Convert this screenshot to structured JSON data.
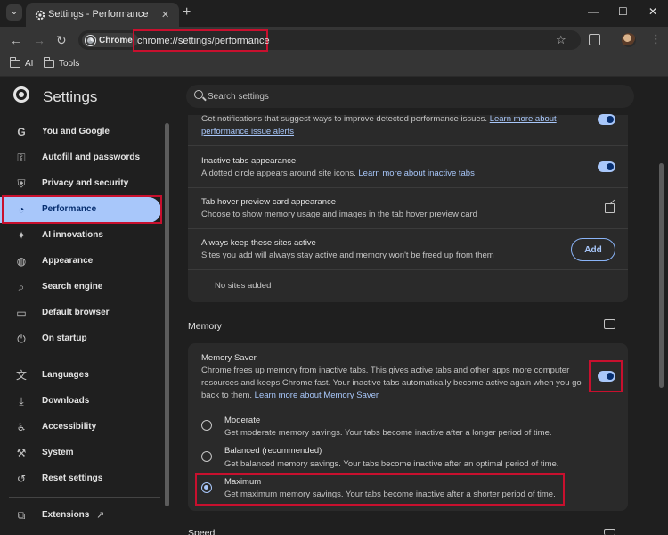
{
  "browser": {
    "tab_title": "Settings - Performance",
    "chip_label": "Chrome",
    "url": "chrome://settings/performance",
    "bookmarks": [
      "AI",
      "Tools"
    ]
  },
  "settings": {
    "title": "Settings",
    "search_placeholder": "Search settings"
  },
  "sidebar": {
    "items": [
      {
        "label": "You and Google",
        "icon": "google-g-icon"
      },
      {
        "label": "Autofill and passwords",
        "icon": "key-icon"
      },
      {
        "label": "Privacy and security",
        "icon": "shield-icon"
      },
      {
        "label": "Performance",
        "icon": "speedometer-icon",
        "active": true
      },
      {
        "label": "AI innovations",
        "icon": "sparkle-icon"
      },
      {
        "label": "Appearance",
        "icon": "palette-icon"
      },
      {
        "label": "Search engine",
        "icon": "search-icon"
      },
      {
        "label": "Default browser",
        "icon": "browser-window-icon"
      },
      {
        "label": "On startup",
        "icon": "power-icon"
      },
      {
        "label": "Languages",
        "icon": "translate-icon"
      },
      {
        "label": "Downloads",
        "icon": "download-icon"
      },
      {
        "label": "Accessibility",
        "icon": "accessibility-icon"
      },
      {
        "label": "System",
        "icon": "wrench-icon"
      },
      {
        "label": "Reset settings",
        "icon": "reset-icon"
      },
      {
        "label": "Extensions",
        "icon": "puzzle-icon"
      }
    ]
  },
  "performance": {
    "alerts_desc_1": "Get notifications that suggest ways to improve detected performance issues.",
    "alerts_link": "Learn more about",
    "alerts_link_2": "performance issue alerts",
    "inactive_title": "Inactive tabs appearance",
    "inactive_desc": "A dotted circle appears around site icons.",
    "inactive_link": "Learn more about inactive tabs",
    "hover_title": "Tab hover preview card appearance",
    "hover_desc": "Choose to show memory usage and images in the tab hover preview card",
    "active_title": "Always keep these sites active",
    "active_desc": "Sites you add will always stay active and memory won't be freed up from them",
    "add_label": "Add",
    "no_sites": "No sites added"
  },
  "memory": {
    "section_title": "Memory",
    "saver_title": "Memory Saver",
    "saver_desc_1": "Chrome frees up memory from inactive tabs. This gives active tabs and other apps more computer",
    "saver_desc_2": "resources and keeps Chrome fast. Your inactive tabs automatically become active again when you go",
    "saver_desc_3": "back to them.",
    "saver_link": "Learn more about Memory Saver",
    "options": [
      {
        "title": "Moderate",
        "desc": "Get moderate memory savings. Your tabs become inactive after a longer period of time.",
        "selected": false
      },
      {
        "title": "Balanced (recommended)",
        "desc": "Get balanced memory savings. Your tabs become inactive after an optimal period of time.",
        "selected": false
      },
      {
        "title": "Maximum",
        "desc": "Get maximum memory savings. Your tabs become inactive after a shorter period of time.",
        "selected": true
      }
    ],
    "next_section_partial": "Speed"
  }
}
